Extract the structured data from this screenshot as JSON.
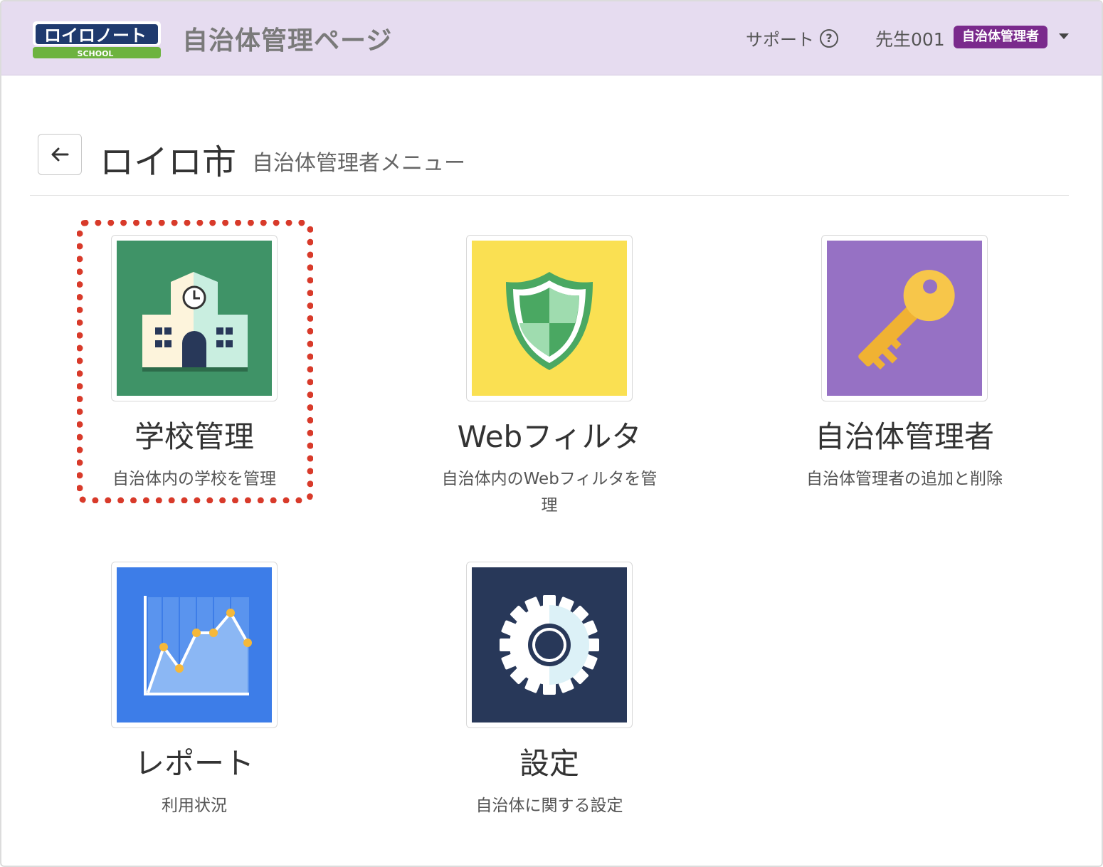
{
  "header": {
    "logo_text": "ロイロノート",
    "logo_sub": "SCHOOL",
    "site_title": "自治体管理ページ",
    "support_label": "サポート",
    "help_icon_glyph": "?",
    "user_name": "先生001",
    "role_badge": "自治体管理者"
  },
  "page": {
    "back_icon": "←",
    "title": "ロイロ市",
    "subtitle": "自治体管理者メニュー"
  },
  "tiles": [
    {
      "icon": "school-building-icon",
      "title": "学校管理",
      "desc": "自治体内の学校を管理",
      "bg": "#3f9367"
    },
    {
      "icon": "shield-icon",
      "title": "Webフィルタ",
      "desc": "自治体内のWebフィルタを管理",
      "bg": "#fae052"
    },
    {
      "icon": "key-icon",
      "title": "自治体管理者",
      "desc": "自治体管理者の追加と削除",
      "bg": "#9671c4"
    },
    {
      "icon": "line-chart-icon",
      "title": "レポート",
      "desc": "利用状況",
      "bg": "#3d7de8"
    },
    {
      "icon": "gear-icon",
      "title": "設定",
      "desc": "自治体に関する設定",
      "bg": "#283859"
    }
  ],
  "colors": {
    "header_bg": "#e6dcf0",
    "badge_bg": "#7a2a8c",
    "highlight": "#d83a2a"
  }
}
